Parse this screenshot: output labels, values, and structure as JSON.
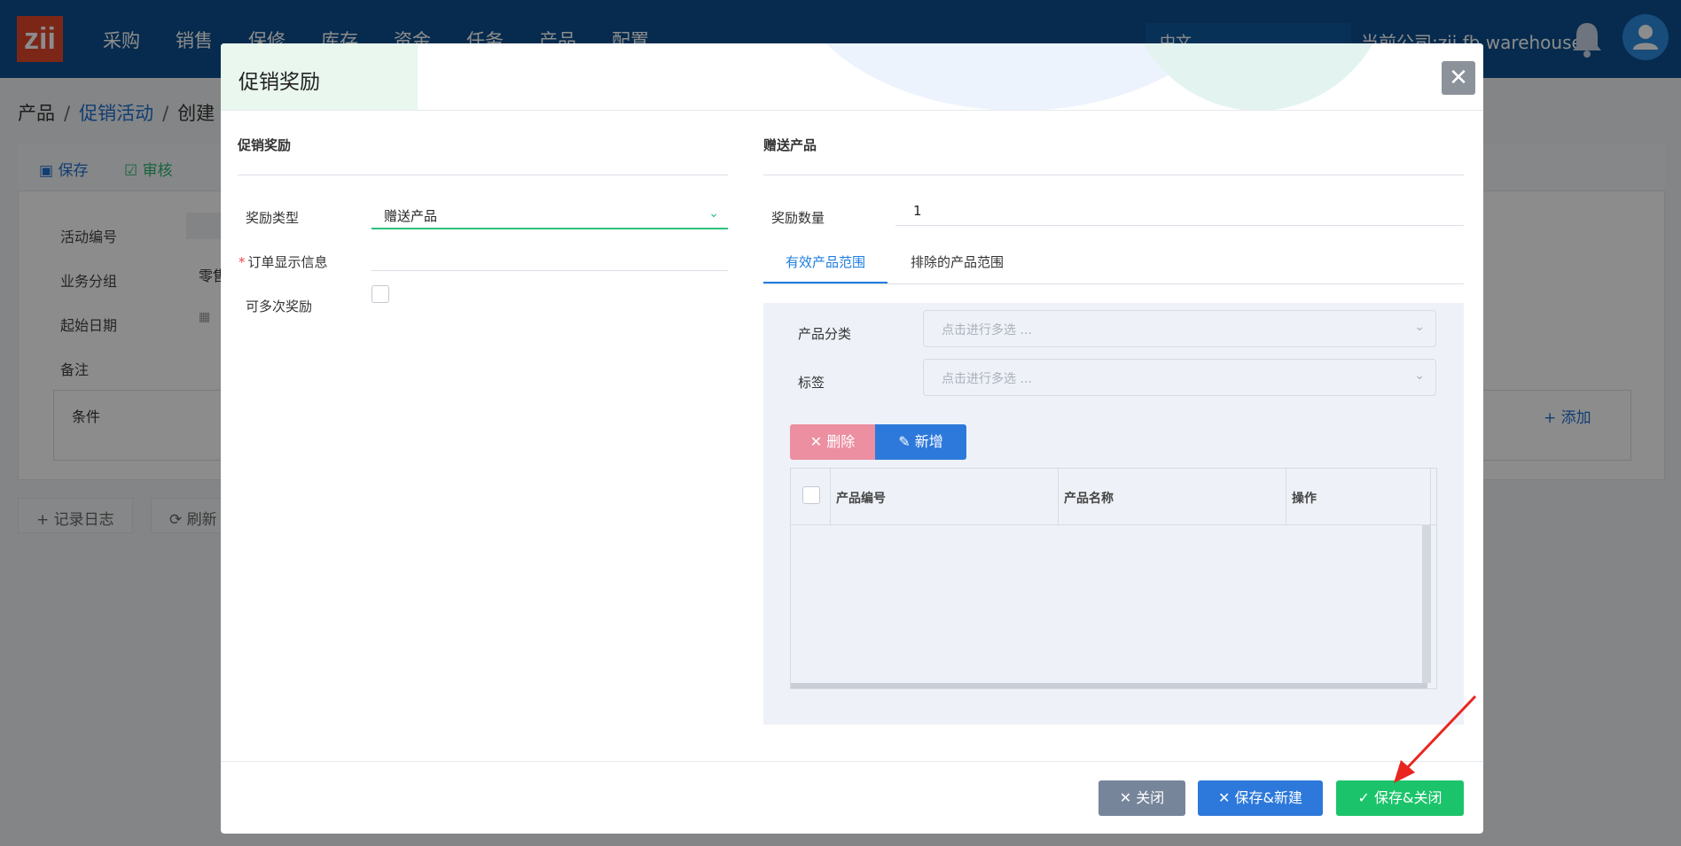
{
  "topbar": {
    "logo": "zii",
    "nav": [
      "采购",
      "销售",
      "保修",
      "库存",
      "资金",
      "任务",
      "产品",
      "配置"
    ],
    "language": "中文",
    "company": "当前公司:zii fb warehouse"
  },
  "breadcrumb": {
    "items": [
      "产品",
      "促销活动",
      "创建"
    ]
  },
  "background": {
    "toolbar": {
      "save": "保存",
      "approve": "审核"
    },
    "fields": [
      "活动编号",
      "业务分组",
      "起始日期",
      "备注"
    ],
    "group_value": "零售",
    "conditions_label": "条件",
    "add_label": "添加",
    "log_button": "记录日志",
    "refresh_button": "刷新"
  },
  "modal": {
    "title": "促销奖励",
    "left": {
      "section_title": "促销奖励",
      "reward_type_label": "奖励类型",
      "reward_type_value": "赠送产品",
      "order_info_label": "订单显示信息",
      "multi_reward_label": "可多次奖励"
    },
    "right": {
      "section_title": "赠送产品",
      "quantity_label": "奖励数量",
      "quantity_value": "1",
      "tabs": [
        "有效产品范围",
        "排除的产品范围"
      ],
      "category_label": "产品分类",
      "category_placeholder": "点击进行多选 ...",
      "tag_label": "标签",
      "tag_placeholder": "点击进行多选 ...",
      "delete_button": "删除",
      "add_button": "新增",
      "columns": [
        "产品编号",
        "产品名称",
        "操作"
      ]
    },
    "footer": {
      "close": "关闭",
      "save_new": "保存&新建",
      "save_close": "保存&关闭"
    }
  },
  "colors": {
    "topbar": "#0b4f8f",
    "accent_green": "#1bc46b",
    "accent_blue": "#2d79db",
    "danger_pink": "#ec8fa1",
    "arrow_red": "#e8261f"
  }
}
